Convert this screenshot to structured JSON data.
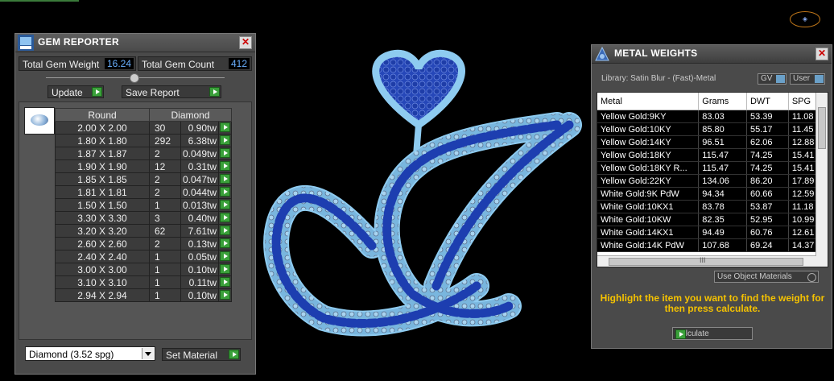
{
  "gem_reporter": {
    "title": "GEM REPORTER",
    "total_weight_label": "Total Gem Weight",
    "total_weight_value": "16.24",
    "total_count_label": "Total Gem Count",
    "total_count_value": "412",
    "update_label": "Update",
    "save_report_label": "Save Report",
    "headers": [
      "Round",
      "Diamond"
    ],
    "rows": [
      {
        "size": "2.00 X 2.00",
        "count": "30",
        "weight": "0.90tw"
      },
      {
        "size": "1.80 X 1.80",
        "count": "292",
        "weight": "6.38tw"
      },
      {
        "size": "1.87 X 1.87",
        "count": "2",
        "weight": "0.049tw"
      },
      {
        "size": "1.90 X 1.90",
        "count": "12",
        "weight": "0.31tw"
      },
      {
        "size": "1.85 X 1.85",
        "count": "2",
        "weight": "0.047tw"
      },
      {
        "size": "1.81 X 1.81",
        "count": "2",
        "weight": "0.044tw"
      },
      {
        "size": "1.50 X 1.50",
        "count": "1",
        "weight": "0.013tw"
      },
      {
        "size": "3.30 X 3.30",
        "count": "3",
        "weight": "0.40tw"
      },
      {
        "size": "3.20 X 3.20",
        "count": "62",
        "weight": "7.61tw"
      },
      {
        "size": "2.60 X 2.60",
        "count": "2",
        "weight": "0.13tw"
      },
      {
        "size": "2.40 X 2.40",
        "count": "1",
        "weight": "0.05tw"
      },
      {
        "size": "3.00 X 3.00",
        "count": "1",
        "weight": "0.10tw"
      },
      {
        "size": "3.10 X 3.10",
        "count": "1",
        "weight": "0.11tw"
      },
      {
        "size": "2.94 X 2.94",
        "count": "1",
        "weight": "0.10tw"
      }
    ],
    "material_select": "Diamond    (3.52 spg)",
    "set_material_label": "Set Material"
  },
  "metal_weights": {
    "title": "METAL WEIGHTS",
    "library": "Library: Satin Blur - (Fast)-Metal",
    "gv_label": "GV",
    "user_label": "User",
    "headers": [
      "Metal",
      "Grams",
      "DWT",
      "SPG"
    ],
    "rows": [
      {
        "metal": "Yellow Gold:9KY",
        "grams": "83.03",
        "dwt": "53.39",
        "spg": "11.08"
      },
      {
        "metal": "Yellow Gold:10KY",
        "grams": "85.80",
        "dwt": "55.17",
        "spg": "11.45"
      },
      {
        "metal": "Yellow Gold:14KY",
        "grams": "96.51",
        "dwt": "62.06",
        "spg": "12.88"
      },
      {
        "metal": "Yellow Gold:18KY",
        "grams": "115.47",
        "dwt": "74.25",
        "spg": "15.41"
      },
      {
        "metal": "Yellow Gold:18KY R...",
        "grams": "115.47",
        "dwt": "74.25",
        "spg": "15.41"
      },
      {
        "metal": "Yellow Gold:22KY",
        "grams": "134.06",
        "dwt": "86.20",
        "spg": "17.89"
      },
      {
        "metal": "White Gold:9K PdW",
        "grams": "94.34",
        "dwt": "60.66",
        "spg": "12.59"
      },
      {
        "metal": "White Gold:10KX1",
        "grams": "83.78",
        "dwt": "53.87",
        "spg": "11.18"
      },
      {
        "metal": "White Gold:10KW",
        "grams": "82.35",
        "dwt": "52.95",
        "spg": "10.99"
      },
      {
        "metal": "White Gold:14KX1",
        "grams": "94.49",
        "dwt": "60.76",
        "spg": "12.61"
      },
      {
        "metal": "White Gold:14K PdW",
        "grams": "107.68",
        "dwt": "69.24",
        "spg": "14.37"
      }
    ],
    "hscroll_label": "III",
    "use_object_materials": "Use Object Materials",
    "hint": "Highlight the item you want to find the weight for then press calculate.",
    "calculate_label": "Calculate"
  },
  "colors": {
    "accent_green": "#3aa03a",
    "value_blue": "#6ab0ff",
    "hint_yellow": "#f5c200",
    "gem_blue": "#1f3fb8",
    "metal_light": "#7fbfe6"
  },
  "icons": [
    "gem-reporter-icon",
    "metal-weights-icon",
    "close-icon",
    "play-arrow-icon",
    "dropdown-arrow-icon",
    "gem-thumbnail-icon"
  ]
}
